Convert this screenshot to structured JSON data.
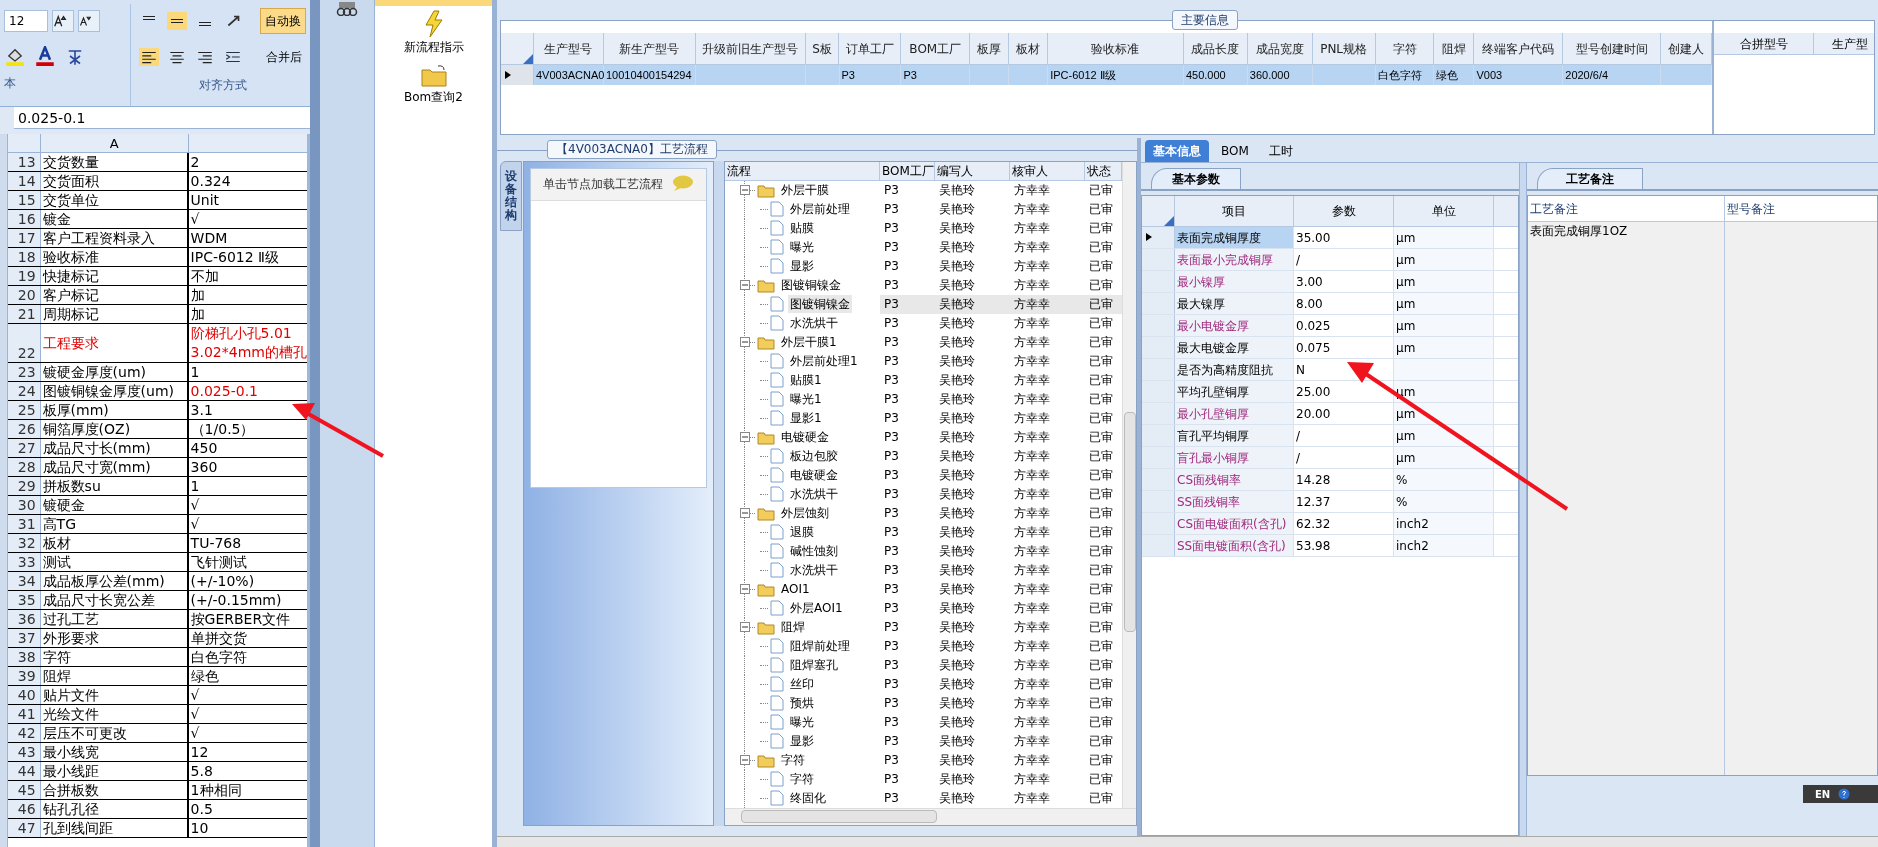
{
  "excel": {
    "font_size": "12",
    "group_labels": [
      "本",
      "对齐方式"
    ],
    "wrap_button": "自动换",
    "merge_button": "合并后",
    "formula": "0.025-0.1",
    "column_header": "A",
    "rows": [
      {
        "num": "13",
        "label": "交货数量",
        "value": "2",
        "label_red": false,
        "value_red": false
      },
      {
        "num": "14",
        "label": "交货面积",
        "value": "0.324",
        "label_red": false,
        "value_red": false
      },
      {
        "num": "15",
        "label": "交货单位",
        "value": "Unit",
        "label_red": false,
        "value_red": false
      },
      {
        "num": "16",
        "label": "镀金",
        "value": "√",
        "label_red": false,
        "value_red": false
      },
      {
        "num": "17",
        "label": "客户工程资料录入",
        "value": "WDM",
        "label_red": false,
        "value_red": false
      },
      {
        "num": "18",
        "label": "验收标准",
        "value": "IPC-6012 Ⅱ级",
        "label_red": false,
        "value_red": false
      },
      {
        "num": "19",
        "label": "快捷标记",
        "value": "不加",
        "label_red": false,
        "value_red": false
      },
      {
        "num": "20",
        "label": "客户标记",
        "value": "加",
        "label_red": false,
        "value_red": false
      },
      {
        "num": "21",
        "label": "周期标记",
        "value": "加",
        "label_red": false,
        "value_red": false
      },
      {
        "num": "22",
        "label": "工程要求",
        "value": "阶梯孔小孔5.01\n3.02*4mm的槽孔",
        "label_red": true,
        "value_red": true
      },
      {
        "num": "23",
        "label": "镀硬金厚度(um)",
        "value": "1",
        "label_red": false,
        "value_red": false
      },
      {
        "num": "24",
        "label": "图镀铜镍金厚度(um)",
        "value": "0.025-0.1",
        "label_red": false,
        "value_red": true
      },
      {
        "num": "25",
        "label": "板厚(mm)",
        "value": "3.1",
        "label_red": false,
        "value_red": false
      },
      {
        "num": "26",
        "label": "铜箔厚度(OZ)",
        "value": "（1/0.5）",
        "label_red": false,
        "value_red": false
      },
      {
        "num": "27",
        "label": "成品尺寸长(mm)",
        "value": "450",
        "label_red": false,
        "value_red": false
      },
      {
        "num": "28",
        "label": "成品尺寸宽(mm)",
        "value": "360",
        "label_red": false,
        "value_red": false
      },
      {
        "num": "29",
        "label": "拼板数su",
        "value": "1",
        "label_red": false,
        "value_red": false
      },
      {
        "num": "30",
        "label": "镀硬金",
        "value": "√",
        "label_red": false,
        "value_red": false
      },
      {
        "num": "31",
        "label": "高TG",
        "value": "√",
        "label_red": false,
        "value_red": false
      },
      {
        "num": "32",
        "label": "板材",
        "value": "TU-768",
        "label_red": false,
        "value_red": false
      },
      {
        "num": "33",
        "label": "测试",
        "value": "飞针测试",
        "label_red": false,
        "value_red": false
      },
      {
        "num": "34",
        "label": "成品板厚公差(mm)",
        "value": "(+/-10%)",
        "label_red": false,
        "value_red": false
      },
      {
        "num": "35",
        "label": "成品尺寸长宽公差",
        "value": "(+/-0.15mm)",
        "label_red": false,
        "value_red": false
      },
      {
        "num": "36",
        "label": "过孔工艺",
        "value": "按GERBER文件",
        "label_red": false,
        "value_red": false
      },
      {
        "num": "37",
        "label": "外形要求",
        "value": "单拼交货",
        "label_red": false,
        "value_red": false
      },
      {
        "num": "38",
        "label": "字符",
        "value": "白色字符",
        "label_red": false,
        "value_red": false
      },
      {
        "num": "39",
        "label": "阻焊",
        "value": "绿色",
        "label_red": false,
        "value_red": false
      },
      {
        "num": "40",
        "label": "贴片文件",
        "value": "√",
        "label_red": false,
        "value_red": false
      },
      {
        "num": "41",
        "label": "光绘文件",
        "value": "√",
        "label_red": false,
        "value_red": false
      },
      {
        "num": "42",
        "label": "层压不可更改",
        "value": "√",
        "label_red": false,
        "value_red": false
      },
      {
        "num": "43",
        "label": "最小线宽",
        "value": "12",
        "label_red": false,
        "value_red": false
      },
      {
        "num": "44",
        "label": "最小线距",
        "value": "5.8",
        "label_red": false,
        "value_red": false
      },
      {
        "num": "45",
        "label": "合拼板数",
        "value": "1种相同",
        "label_red": false,
        "value_red": false
      },
      {
        "num": "46",
        "label": "钻孔孔径",
        "value": "0.5",
        "label_red": false,
        "value_red": false
      },
      {
        "num": "47",
        "label": "孔到线间距",
        "value": "10",
        "label_red": false,
        "value_red": false
      }
    ]
  },
  "nav": {
    "items": [
      {
        "kind": "lightning",
        "label": "新流程指示"
      },
      {
        "kind": "folder",
        "label": "Bom查询2"
      }
    ]
  },
  "main_info": {
    "title": "主要信息",
    "columns": [
      "生产型号",
      "新生产型号",
      "升级前旧生产型号",
      "S板",
      "订单工厂",
      "BOM工厂",
      "板厚",
      "板材",
      "验收标准",
      "成品长度",
      "成品宽度",
      "PNL规格",
      "字符",
      "阻焊",
      "终端客户代码",
      "型号创建时间",
      "创建人"
    ],
    "rows": [
      {
        "selected": true,
        "cells": [
          "4V003ACNA0",
          "10010400154294",
          null,
          null,
          "P3",
          "P3",
          null,
          null,
          "IPC-6012 Ⅱ级",
          "450.000",
          "360.000",
          null,
          "白色字符",
          "绿色",
          "V003",
          "2020/6/4",
          null
        ]
      }
    ],
    "side_columns": [
      "合拼型号",
      "生产型"
    ]
  },
  "process": {
    "title": "【4V003ACNA0】工艺流程",
    "side_tab": "设备结构",
    "hint": "单击节点加载工艺流程",
    "columns": [
      "流程",
      "BOM工厂",
      "编写人",
      "核审人",
      "状态"
    ],
    "tree": [
      {
        "name": "外层干膜",
        "factory": "P3",
        "writer": "吴艳玲",
        "reviewer": "方幸幸",
        "status": "已审",
        "expanded": true,
        "selected": false,
        "children": [
          {
            "name": "外层前处理",
            "factory": "P3",
            "writer": "吴艳玲",
            "reviewer": "方幸幸",
            "status": "已审",
            "selected": false
          },
          {
            "name": "贴膜",
            "factory": "P3",
            "writer": "吴艳玲",
            "reviewer": "方幸幸",
            "status": "已审",
            "selected": false
          },
          {
            "name": "曝光",
            "factory": "P3",
            "writer": "吴艳玲",
            "reviewer": "方幸幸",
            "status": "已审",
            "selected": false
          },
          {
            "name": "显影",
            "factory": "P3",
            "writer": "吴艳玲",
            "reviewer": "方幸幸",
            "status": "已审",
            "selected": false
          }
        ]
      },
      {
        "name": "图镀铜镍金",
        "factory": "P3",
        "writer": "吴艳玲",
        "reviewer": "方幸幸",
        "status": "已审",
        "expanded": true,
        "selected": false,
        "children": [
          {
            "name": "图镀铜镍金",
            "factory": "P3",
            "writer": "吴艳玲",
            "reviewer": "方幸幸",
            "status": "已审",
            "selected": true
          },
          {
            "name": "水洗烘干",
            "factory": "P3",
            "writer": "吴艳玲",
            "reviewer": "方幸幸",
            "status": "已审",
            "selected": false
          }
        ]
      },
      {
        "name": "外层干膜1",
        "factory": "P3",
        "writer": "吴艳玲",
        "reviewer": "方幸幸",
        "status": "已审",
        "expanded": true,
        "selected": false,
        "children": [
          {
            "name": "外层前处理1",
            "factory": "P3",
            "writer": "吴艳玲",
            "reviewer": "方幸幸",
            "status": "已审",
            "selected": false
          },
          {
            "name": "贴膜1",
            "factory": "P3",
            "writer": "吴艳玲",
            "reviewer": "方幸幸",
            "status": "已审",
            "selected": false
          },
          {
            "name": "曝光1",
            "factory": "P3",
            "writer": "吴艳玲",
            "reviewer": "方幸幸",
            "status": "已审",
            "selected": false
          },
          {
            "name": "显影1",
            "factory": "P3",
            "writer": "吴艳玲",
            "reviewer": "方幸幸",
            "status": "已审",
            "selected": false
          }
        ]
      },
      {
        "name": "电镀硬金",
        "factory": "P3",
        "writer": "吴艳玲",
        "reviewer": "方幸幸",
        "status": "已审",
        "expanded": true,
        "selected": false,
        "children": [
          {
            "name": "板边包胶",
            "factory": "P3",
            "writer": "吴艳玲",
            "reviewer": "方幸幸",
            "status": "已审",
            "selected": false
          },
          {
            "name": "电镀硬金",
            "factory": "P3",
            "writer": "吴艳玲",
            "reviewer": "方幸幸",
            "status": "已审",
            "selected": false
          },
          {
            "name": "水洗烘干",
            "factory": "P3",
            "writer": "吴艳玲",
            "reviewer": "方幸幸",
            "status": "已审",
            "selected": false
          }
        ]
      },
      {
        "name": "外层蚀刻",
        "factory": "P3",
        "writer": "吴艳玲",
        "reviewer": "方幸幸",
        "status": "已审",
        "expanded": true,
        "selected": false,
        "children": [
          {
            "name": "退膜",
            "factory": "P3",
            "writer": "吴艳玲",
            "reviewer": "方幸幸",
            "status": "已审",
            "selected": false
          },
          {
            "name": "碱性蚀刻",
            "factory": "P3",
            "writer": "吴艳玲",
            "reviewer": "方幸幸",
            "status": "已审",
            "selected": false
          },
          {
            "name": "水洗烘干",
            "factory": "P3",
            "writer": "吴艳玲",
            "reviewer": "方幸幸",
            "status": "已审",
            "selected": false
          }
        ]
      },
      {
        "name": "AOI1",
        "factory": "P3",
        "writer": "吴艳玲",
        "reviewer": "方幸幸",
        "status": "已审",
        "expanded": true,
        "selected": false,
        "children": [
          {
            "name": "外层AOI1",
            "factory": "P3",
            "writer": "吴艳玲",
            "reviewer": "方幸幸",
            "status": "已审",
            "selected": false
          }
        ]
      },
      {
        "name": "阻焊",
        "factory": "P3",
        "writer": "吴艳玲",
        "reviewer": "方幸幸",
        "status": "已审",
        "expanded": true,
        "selected": false,
        "children": [
          {
            "name": "阻焊前处理",
            "factory": "P3",
            "writer": "吴艳玲",
            "reviewer": "方幸幸",
            "status": "已审",
            "selected": false
          },
          {
            "name": "阻焊塞孔",
            "factory": "P3",
            "writer": "吴艳玲",
            "reviewer": "方幸幸",
            "status": "已审",
            "selected": false
          },
          {
            "name": "丝印",
            "factory": "P3",
            "writer": "吴艳玲",
            "reviewer": "方幸幸",
            "status": "已审",
            "selected": false
          },
          {
            "name": "预烘",
            "factory": "P3",
            "writer": "吴艳玲",
            "reviewer": "方幸幸",
            "status": "已审",
            "selected": false
          },
          {
            "name": "曝光",
            "factory": "P3",
            "writer": "吴艳玲",
            "reviewer": "方幸幸",
            "status": "已审",
            "selected": false
          },
          {
            "name": "显影",
            "factory": "P3",
            "writer": "吴艳玲",
            "reviewer": "方幸幸",
            "status": "已审",
            "selected": false
          }
        ]
      },
      {
        "name": "字符",
        "factory": "P3",
        "writer": "吴艳玲",
        "reviewer": "方幸幸",
        "status": "已审",
        "expanded": true,
        "selected": false,
        "children": [
          {
            "name": "字符",
            "factory": "P3",
            "writer": "吴艳玲",
            "reviewer": "方幸幸",
            "status": "已审",
            "selected": false
          },
          {
            "name": "终固化",
            "factory": "P3",
            "writer": "吴艳玲",
            "reviewer": "方幸幸",
            "status": "已审",
            "selected": false
          }
        ]
      }
    ]
  },
  "params": {
    "tabs": [
      {
        "label": "基本信息",
        "selected": true
      },
      {
        "label": "BOM",
        "selected": false
      },
      {
        "label": "工时",
        "selected": false
      }
    ],
    "subtab": "基本参数",
    "columns": [
      "项目",
      "参数",
      "单位"
    ],
    "rows": [
      {
        "item": "表面完成铜厚度",
        "value": "35.00",
        "unit": "μm",
        "kind": "plain",
        "selected": true
      },
      {
        "item": "表面最小完成铜厚",
        "value": "/",
        "unit": "μm",
        "kind": "highlighted",
        "selected": false
      },
      {
        "item": "最小镍厚",
        "value": "3.00",
        "unit": "μm",
        "kind": "highlighted",
        "selected": false
      },
      {
        "item": "最大镍厚",
        "value": "8.00",
        "unit": "μm",
        "kind": "plain",
        "selected": false
      },
      {
        "item": "最小电镀金厚",
        "value": "0.025",
        "unit": "μm",
        "kind": "highlighted",
        "selected": false
      },
      {
        "item": "最大电镀金厚",
        "value": "0.075",
        "unit": "μm",
        "kind": "plain",
        "selected": false
      },
      {
        "item": "是否为高精度阻抗",
        "value": "N",
        "kind": "plain",
        "selected": false
      },
      {
        "item": "平均孔壁铜厚",
        "value": "25.00",
        "unit": "μm",
        "kind": "plain",
        "selected": false
      },
      {
        "item": "最小孔壁铜厚",
        "value": "20.00",
        "unit": "μm",
        "kind": "highlighted",
        "selected": false
      },
      {
        "item": "盲孔平均铜厚",
        "value": "/",
        "unit": "μm",
        "kind": "plain",
        "selected": false
      },
      {
        "item": "盲孔最小铜厚",
        "value": "/",
        "unit": "μm",
        "kind": "highlighted",
        "selected": false
      },
      {
        "item": "CS面残铜率",
        "value": "14.28",
        "unit": "%",
        "kind": "highlighted",
        "selected": false
      },
      {
        "item": "SS面残铜率",
        "value": "12.37",
        "unit": "%",
        "kind": "highlighted",
        "selected": false
      },
      {
        "item": "CS面电镀面积(含孔)",
        "value": "62.32",
        "unit": "inch2",
        "kind": "highlighted",
        "selected": false
      },
      {
        "item": "SS面电镀面积(含孔)",
        "value": "53.98",
        "unit": "inch2",
        "kind": "highlighted",
        "selected": false
      }
    ]
  },
  "notes": {
    "tab": "工艺备注",
    "columns": [
      "工艺备注",
      "型号备注"
    ],
    "text": "表面完成铜厚1OZ"
  },
  "ime": {
    "label": "EN"
  }
}
